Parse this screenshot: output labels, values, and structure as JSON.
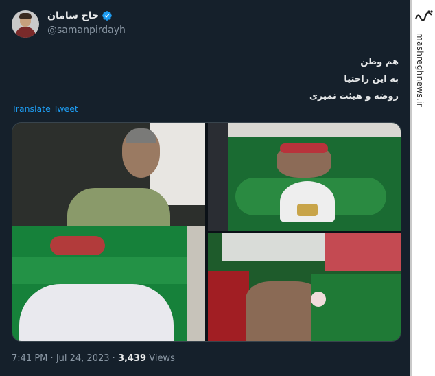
{
  "tweet": {
    "display_name": "حاج سامان",
    "handle": "@samanpirdayh",
    "text_lines": [
      "هم وطن",
      "به این راحتیا",
      "روضه و هیئت نمیری"
    ],
    "translate_label": "Translate Tweet",
    "time": "7:41 PM",
    "date": "Jul 24, 2023",
    "views_count": "3,439",
    "views_label": "Views",
    "separator": "·"
  },
  "watermark": {
    "logo_text": "مشرق",
    "site": "mashreghnews.ir"
  },
  "colors": {
    "background": "#15202b",
    "accent": "#1d9bf0",
    "muted": "#8b98a5",
    "text": "#e7e9ea"
  },
  "icons": [
    "verified-badge-icon"
  ]
}
